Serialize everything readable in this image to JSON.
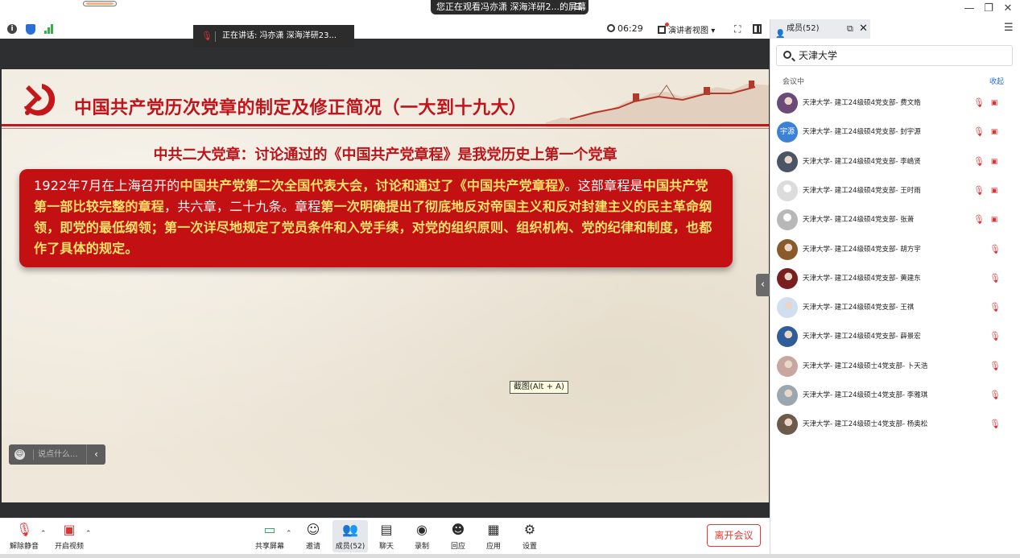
{
  "titlebar": {
    "watching": "您正在观看冯亦潇 深海洋研2...的屏幕",
    "menu_icon": "menu-icon",
    "minimize": "—",
    "restore": "❐",
    "close": "✕"
  },
  "topbar": {
    "speaking_prefix": "正在讲话:",
    "speaking_name": "冯亦潇 深海洋研23...",
    "timer": "06:29",
    "view_mode": "演讲者视图"
  },
  "slide": {
    "title": "中国共产党历次党章的制定及修正简况（一大到十九大）",
    "subtitle": "中共二大党章：讨论通过的《中国共产党章程》是我党历史上第一个党章",
    "body": [
      {
        "t": "1922年7月在上海召开的",
        "y": false
      },
      {
        "t": "中国共产党第二次全国代表大会，讨论和通过了《中国共产党章程》",
        "y": true
      },
      {
        "t": "。这部章程是",
        "y": false
      },
      {
        "t": "中国共产党第一部比较完整的章程",
        "y": true
      },
      {
        "t": "，共六章，二十九条。章程",
        "y": false
      },
      {
        "t": "第一次明确提出了彻底地反对帝国主义和反对封建主义的民主革命纲领，即党的最低纲领；第一次详尽地规定了党员条件和入党手续，对党的组织原则、组织机构、党的纪律和制度，也都作了具体的规定。",
        "y": true
      }
    ],
    "colors": {
      "red": "#c31013",
      "highlight": "#ffe36a"
    }
  },
  "tooltip": "截图(Alt + A)",
  "chat": {
    "placeholder": "说点什么..."
  },
  "toolbar": {
    "unmute": "解除静音",
    "start_video": "开启视频",
    "share": "共享屏幕",
    "invite": "邀请",
    "members": "成员(52)",
    "chat": "聊天",
    "record": "录制",
    "reactions": "回应",
    "apps": "应用",
    "settings": "设置",
    "leave": "离开会议"
  },
  "panel": {
    "tab": "成员(52)",
    "search_value": "天津大学",
    "section": "会议中",
    "collapse": "收起",
    "members": [
      {
        "name": "天津大学- 建工24级硕4党支部- 费文皓",
        "avatar": "photo",
        "color": "#6b4a7a",
        "cam": true
      },
      {
        "name": "天津大学- 建工24级硕4党支部- 封宇源",
        "avatar": "宇源",
        "color": "#3b82d6",
        "cam": true
      },
      {
        "name": "天津大学- 建工24级硕4党支部- 李嶋贤",
        "avatar": "photo",
        "color": "#4a5566",
        "cam": true
      },
      {
        "name": "天津大学- 建工24级硕4党支部- 王时雨",
        "avatar": "default",
        "color": "#dcdcdc",
        "cam": true
      },
      {
        "name": "天津大学- 建工24级硕4党支部- 张萧",
        "avatar": "default",
        "color": "#b8b8b8",
        "cam": true
      },
      {
        "name": "天津大学- 建工24级硕4党支部- 胡方宇",
        "avatar": "photo",
        "color": "#8a5a2b",
        "cam": false
      },
      {
        "name": "天津大学- 建工24级硕4党支部- 黄建东",
        "avatar": "photo",
        "color": "#7a1f1f",
        "cam": false
      },
      {
        "name": "天津大学- 建工24级硕4党支部- 王祺",
        "avatar": "photo",
        "color": "#cfdff0",
        "cam": false
      },
      {
        "name": "天津大学- 建工24级硕4党支部- 薛景宏",
        "avatar": "photo",
        "color": "#2e5d9a",
        "cam": false
      },
      {
        "name": "天津大学- 建工24级硕士4党支部- 卜天浩",
        "avatar": "photo",
        "color": "#c9a7a0",
        "cam": false
      },
      {
        "name": "天津大学- 建工24级硕士4党支部- 李雅琪",
        "avatar": "photo",
        "color": "#9aa6b0",
        "cam": false
      },
      {
        "name": "天津大学- 建工24级硕士4党支部- 杨奥松",
        "avatar": "photo",
        "color": "#6e5a4a",
        "cam": false
      }
    ]
  }
}
